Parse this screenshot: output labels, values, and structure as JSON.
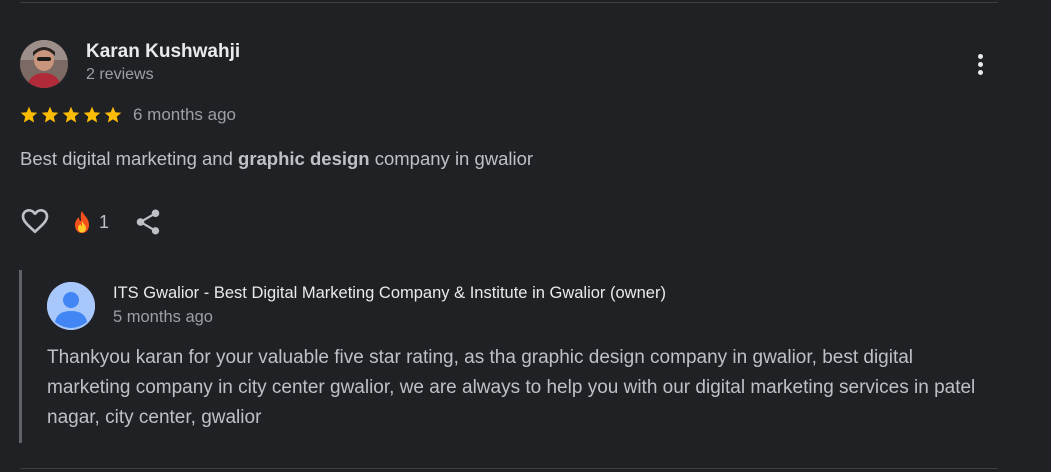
{
  "review": {
    "reviewer_name": "Karan Kushwahji",
    "reviewer_meta": "2 reviews",
    "rating": 5,
    "max_rating": 5,
    "time": "6 months ago",
    "text_before": "Best digital marketing and ",
    "text_bold": "graphic design",
    "text_after": " company in gwalior",
    "reaction_count": "1"
  },
  "owner_response": {
    "name": "ITS Gwalior - Best Digital Marketing Company & Institute in Gwalior (owner)",
    "time": "5 months ago",
    "text": "Thankyou karan for your valuable five star rating, as tha graphic design company in gwalior, best digital marketing company in city center gwalior, we are always to help you with our digital marketing services in patel nagar, city center, gwalior"
  },
  "icons": {
    "more": "more-vert-icon",
    "star": "star-icon",
    "like": "heart-outline-icon",
    "reaction": "fire-emoji-icon",
    "share": "share-icon"
  },
  "colors": {
    "background": "#202124",
    "star": "#fbbc04",
    "primary_text": "#e8eaed",
    "secondary_text": "#9aa0a6",
    "body_text": "#bdc1c6"
  }
}
